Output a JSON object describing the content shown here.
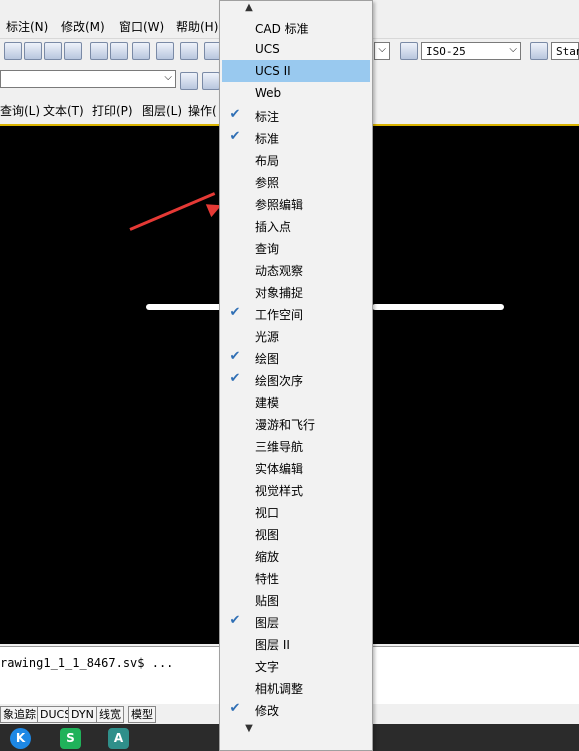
{
  "menubar": {
    "items": [
      "标注(N)",
      "修改(M)",
      "窗口(W)",
      "帮助(H)"
    ]
  },
  "toolbar": {
    "dimstyle_value": "ISO-25",
    "tablestyle_value": "Stan"
  },
  "tabs": [
    "查询(L)",
    "文本(T)",
    "打印(P)",
    "图层(L)",
    "操作("
  ],
  "context_menu": {
    "scroll_up_glyph": "▲",
    "scroll_down_glyph": "▼",
    "check_glyph": "✔",
    "items": [
      {
        "label": "CAD 标准",
        "checked": false,
        "highlighted": false
      },
      {
        "label": "UCS",
        "checked": false,
        "highlighted": false
      },
      {
        "label": "UCS II",
        "checked": false,
        "highlighted": true
      },
      {
        "label": "Web",
        "checked": false,
        "highlighted": false
      },
      {
        "label": "标注",
        "checked": true,
        "highlighted": false
      },
      {
        "label": "标准",
        "checked": true,
        "highlighted": false
      },
      {
        "label": "布局",
        "checked": false,
        "highlighted": false
      },
      {
        "label": "参照",
        "checked": false,
        "highlighted": false
      },
      {
        "label": "参照编辑",
        "checked": false,
        "highlighted": false
      },
      {
        "label": "插入点",
        "checked": false,
        "highlighted": false
      },
      {
        "label": "查询",
        "checked": false,
        "highlighted": false
      },
      {
        "label": "动态观察",
        "checked": false,
        "highlighted": false
      },
      {
        "label": "对象捕捉",
        "checked": false,
        "highlighted": false
      },
      {
        "label": "工作空间",
        "checked": true,
        "highlighted": false
      },
      {
        "label": "光源",
        "checked": false,
        "highlighted": false
      },
      {
        "label": "绘图",
        "checked": true,
        "highlighted": false
      },
      {
        "label": "绘图次序",
        "checked": true,
        "highlighted": false
      },
      {
        "label": "建模",
        "checked": false,
        "highlighted": false
      },
      {
        "label": "漫游和飞行",
        "checked": false,
        "highlighted": false
      },
      {
        "label": "三维导航",
        "checked": false,
        "highlighted": false
      },
      {
        "label": "实体编辑",
        "checked": false,
        "highlighted": false
      },
      {
        "label": "视觉样式",
        "checked": false,
        "highlighted": false
      },
      {
        "label": "视口",
        "checked": false,
        "highlighted": false
      },
      {
        "label": "视图",
        "checked": false,
        "highlighted": false
      },
      {
        "label": "缩放",
        "checked": false,
        "highlighted": false
      },
      {
        "label": "特性",
        "checked": false,
        "highlighted": false
      },
      {
        "label": "贴图",
        "checked": false,
        "highlighted": false
      },
      {
        "label": "图层",
        "checked": true,
        "highlighted": false
      },
      {
        "label": "图层 II",
        "checked": false,
        "highlighted": false
      },
      {
        "label": "文字",
        "checked": false,
        "highlighted": false
      },
      {
        "label": "相机调整",
        "checked": false,
        "highlighted": false
      },
      {
        "label": "修改",
        "checked": true,
        "highlighted": false
      }
    ]
  },
  "command_line": {
    "text": "rawing1_1_1_8467.sv$ ..."
  },
  "statusbar": {
    "buttons": [
      "象追踪",
      "DUCS",
      "DYN",
      "线宽",
      "模型"
    ]
  },
  "taskbar": {
    "apps": [
      {
        "label": "K",
        "color": "#1e88e5"
      },
      {
        "label": "S",
        "color": "#20b25a"
      },
      {
        "label": "A",
        "color": "#2f8f8a"
      }
    ]
  },
  "colors": {
    "canvas": "#000000",
    "highlight": "#99c9ef",
    "arrow": "#e53935",
    "check": "#2f6fb5"
  }
}
